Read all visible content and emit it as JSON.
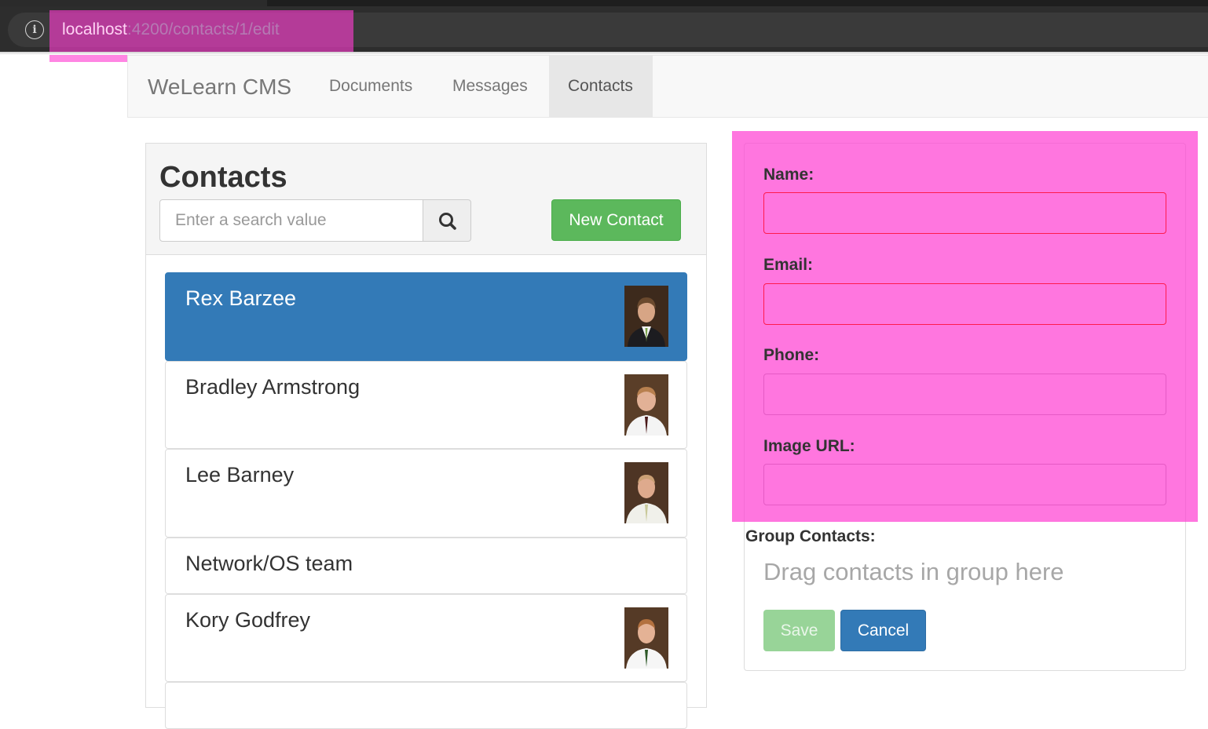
{
  "browser": {
    "url_host": "localhost",
    "url_path": ":4200/contacts/1/edit"
  },
  "navbar": {
    "brand": "WeLearn CMS",
    "items": [
      {
        "label": "Documents"
      },
      {
        "label": "Messages"
      },
      {
        "label": "Contacts",
        "active": true
      }
    ]
  },
  "contacts_panel": {
    "title": "Contacts",
    "search_placeholder": "Enter a search value",
    "new_contact_label": "New Contact",
    "contacts": [
      {
        "name": "Rex Barzee",
        "active": true,
        "has_image": true
      },
      {
        "name": "Bradley Armstrong",
        "has_image": true
      },
      {
        "name": "Lee Barney",
        "has_image": true
      },
      {
        "name": "Network/OS team",
        "has_image": false
      },
      {
        "name": "Kory Godfrey",
        "has_image": true
      }
    ]
  },
  "edit_form": {
    "name_label": "Name:",
    "email_label": "Email:",
    "phone_label": "Phone:",
    "image_url_label": "Image URL:",
    "group_label": "Group Contacts:",
    "group_drop_hint": "Drag contacts in group here",
    "save_label": "Save",
    "cancel_label": "Cancel"
  },
  "colors": {
    "highlight": "#ff3cd2",
    "primary": "#337ab7",
    "success": "#5cb85c",
    "invalid_border": "#ff1a4d"
  },
  "icons": [
    "info-icon",
    "search-icon"
  ]
}
